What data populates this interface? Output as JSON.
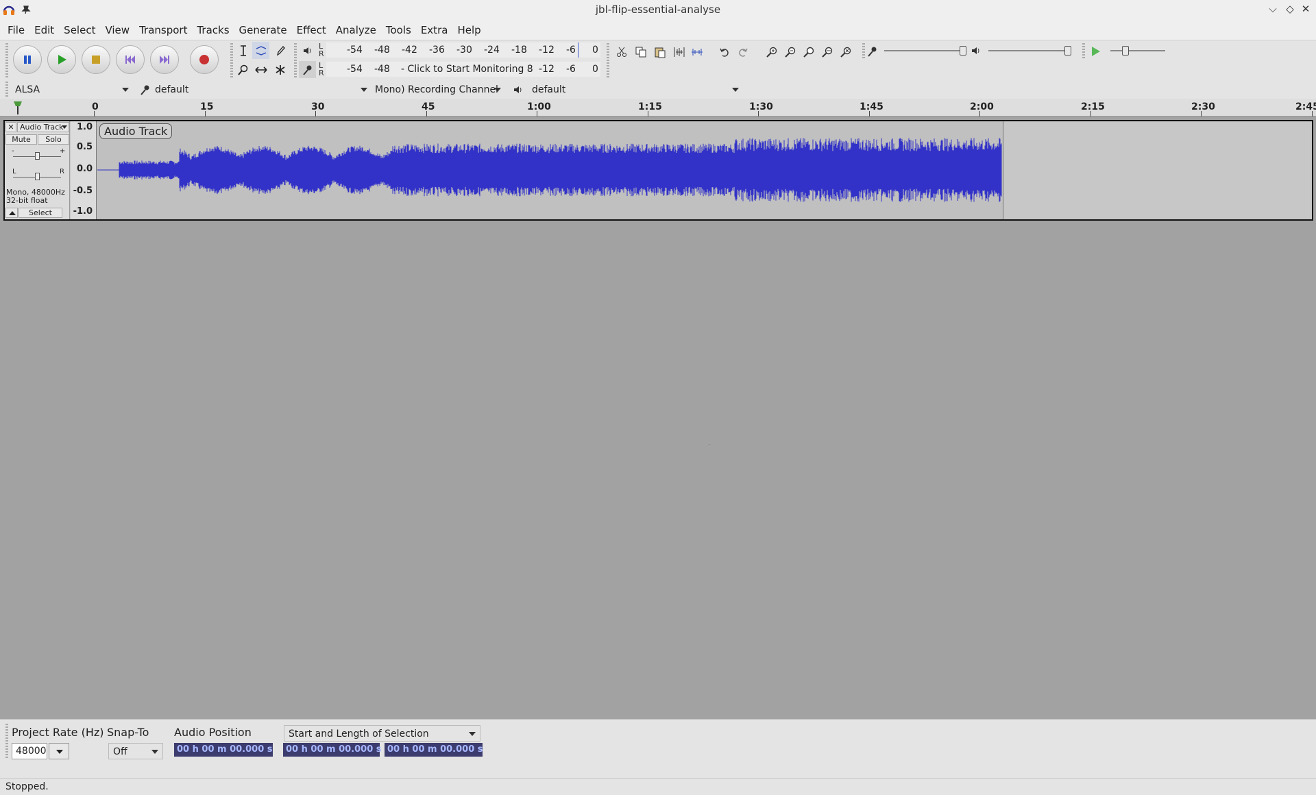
{
  "window": {
    "title": "jbl-flip-essential-analyse"
  },
  "menu": [
    "File",
    "Edit",
    "Select",
    "View",
    "Transport",
    "Tracks",
    "Generate",
    "Effect",
    "Analyze",
    "Tools",
    "Extra",
    "Help"
  ],
  "meters": {
    "ticks": [
      "-54",
      "-48",
      "-42",
      "-36",
      "-30",
      "-24",
      "-18",
      "-12",
      "-6",
      "0"
    ],
    "rec_ticks": [
      "-54",
      "-48",
      "-12",
      "-6",
      "0"
    ],
    "rec_hint": "- Click to Start Monitoring 8",
    "l": "L",
    "r": "R"
  },
  "device": {
    "host": "ALSA",
    "recording_device": "default",
    "channels": "Mono) Recording Channel",
    "playback_device": "default"
  },
  "ruler": {
    "labels": [
      "0",
      "15",
      "30",
      "45",
      "1:00",
      "1:15",
      "1:30",
      "1:45",
      "2:00",
      "2:15",
      "2:30",
      "2:45"
    ]
  },
  "track": {
    "name": "Audio Track",
    "clip_name": "Audio Track",
    "mute": "Mute",
    "solo": "Solo",
    "gain_minus": "-",
    "gain_plus": "+",
    "pan_l": "L",
    "pan_r": "R",
    "info1": "Mono, 48000Hz",
    "info2": "32-bit float",
    "select": "Select",
    "scale": [
      "1.0",
      "0.5",
      "0.0",
      "-0.5",
      "-1.0"
    ],
    "waveform_color": "#3232c8"
  },
  "selection": {
    "project_rate_label": "Project Rate (Hz)",
    "project_rate": "48000",
    "snap_label": "Snap-To",
    "snap_value": "Off",
    "audio_position_label": "Audio Position",
    "audio_position": "00 h 00 m 00.000 s",
    "selection_mode": "Start and Length of Selection",
    "sel_start": "00 h 00 m 00.000 s",
    "sel_length": "00 h 00 m 00.000 s"
  },
  "status": "Stopped."
}
